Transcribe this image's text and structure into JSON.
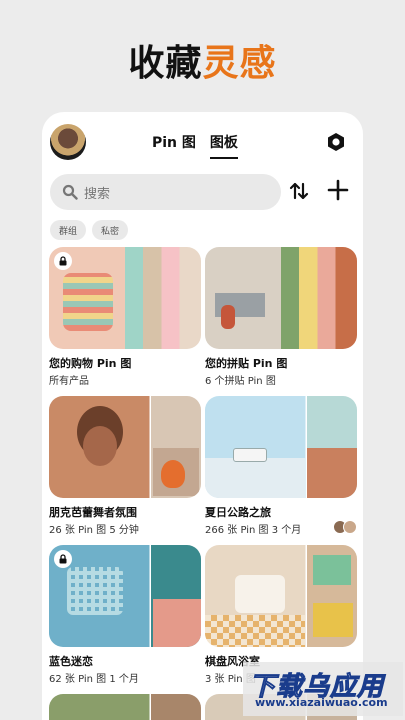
{
  "headline": {
    "part1": "收藏",
    "part2": "灵感"
  },
  "header": {
    "tab_pins": "Pin 图",
    "tab_boards": "图板"
  },
  "search": {
    "placeholder": "搜索"
  },
  "chips": [
    "群组",
    "私密"
  ],
  "boards": [
    {
      "title": "您的购物 Pin 图",
      "subtitle": "所有产品",
      "private": true
    },
    {
      "title": "您的拼贴 Pin 图",
      "subtitle": "6 个拼贴 Pin 图",
      "private": false
    },
    {
      "title": "朋克芭蕾舞者氛围",
      "subtitle": "26 张 Pin 图 5 分钟",
      "private": false
    },
    {
      "title": "夏日公路之旅",
      "subtitle": "266 张 Pin 图 3 个月",
      "private": false,
      "collaborators": true
    },
    {
      "title": "蓝色迷恋",
      "subtitle": "62 张 Pin 图 1 个月",
      "private": true
    },
    {
      "title": "棋盘风浴室",
      "subtitle": "3 张 Pin 图",
      "private": false
    }
  ],
  "watermark": {
    "big": "下载乌应用",
    "small": "www.xiazaiwuao.com"
  },
  "colors": {
    "accent": "#e8751a",
    "text": "#111111",
    "chip_bg": "#e9e9e9"
  },
  "icons": [
    "search-icon",
    "sort-icon",
    "plus-icon",
    "settings-hex-icon",
    "lock-icon"
  ]
}
